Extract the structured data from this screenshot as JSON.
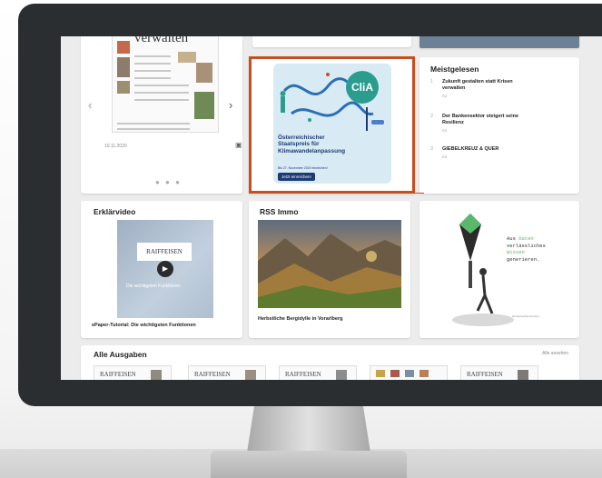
{
  "slider": {
    "headline": "verwalten",
    "date": "10.11.2020",
    "prev_arrow": "‹",
    "next_arrow": "›",
    "doc_icon": "▣",
    "dots": "● ● ●"
  },
  "ad": {
    "logo": "CliA",
    "title_line1": "Österreichischer",
    "title_line2": "Staatspreis für",
    "title_line3": "Klimawandelanpassung",
    "date": "Bis 27. November 2020 einreichen!",
    "button": "Jetzt einreichen!"
  },
  "meistgelesen": {
    "title": "Meistgelesen",
    "items": [
      {
        "num": "1",
        "text": "Zukunft gestalten statt Krisen verwalten",
        "tag": "RZ"
      },
      {
        "num": "2",
        "text": "Der Bankensektor steigert seine Resilienz",
        "tag": "RZ"
      },
      {
        "num": "3",
        "text": "GIEBELKREUZ & QUER",
        "tag": "RZ"
      }
    ]
  },
  "erklaervideo": {
    "title": "Erklärvideo",
    "video_logo": "RAIFFEISEN",
    "video_caption": "Die wichtigsten Funktionen",
    "caption": "ePaper-Tutorial: Die wichtigsten Funktionen"
  },
  "rss": {
    "title": "RSS Immo",
    "caption": "Herbstliche Bergidylle in Vorarlberg"
  },
  "art": {
    "line1_prefix": "Aus ",
    "line1_green": "Daten",
    "line2": "verlässliches",
    "line3": "Wissen",
    "line4": "generieren.",
    "footer": "bundesrechenzentrum"
  },
  "ausgaben": {
    "title": "Alle Ausgaben",
    "link": "Alle ansehen",
    "thumbs": [
      "RAIFFEISEN",
      "RAIFFEISEN",
      "RAIFFEISEN",
      "",
      "RAIFFEISEN"
    ]
  },
  "colors": {
    "highlight": "#c4501f",
    "ad_navy": "#1e3a73",
    "clia_teal": "#2a9d8f",
    "bezel": "#2b2e31"
  }
}
